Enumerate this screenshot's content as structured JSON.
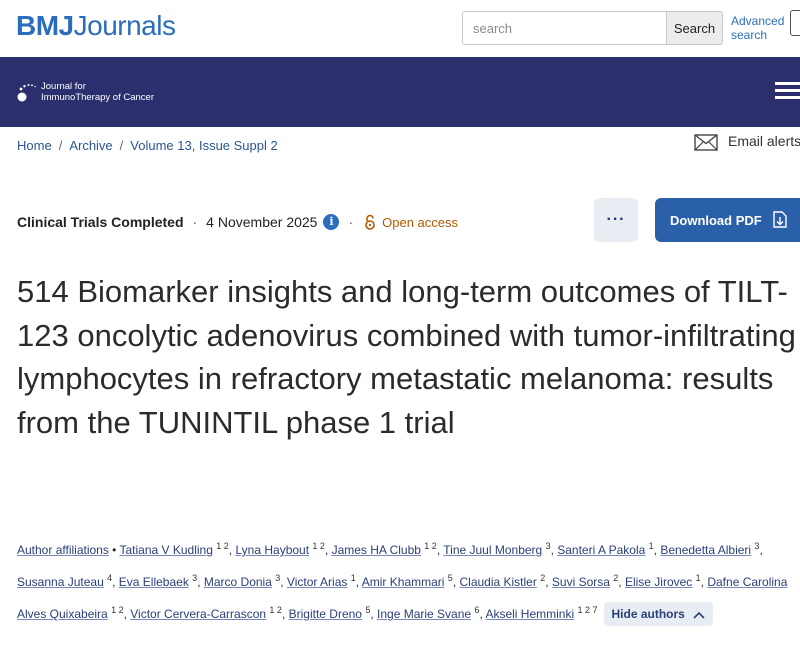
{
  "header": {
    "brand_bmj": "BMJ",
    "brand_journals": "Journals",
    "search_placeholder": "search",
    "search_button": "Search",
    "advanced_search": "Advanced search"
  },
  "banner": {
    "journal_line1": "Journal for",
    "journal_line2": "ImmunoTherapy of Cancer",
    "menu_icon": "hamburger-icon",
    "bg_color": "#2b2f6e"
  },
  "breadcrumb": [
    "Home",
    "Archive",
    "Volume 13, Issue Suppl 2"
  ],
  "email_alerts": "Email alerts",
  "article": {
    "type": "Clinical Trials Completed",
    "date": "4 November 2025",
    "info_icon": "i",
    "access": "Open access",
    "more_button": "···",
    "download_button": "Download PDF",
    "title": "514 Biomarker insights and long-term outcomes of TILT-123 oncolytic adenovirus combined with tumor-infiltrating lymphocytes in refractory metastatic melanoma: results from the TUNINTIL phase 1 trial"
  },
  "authors": {
    "affiliations_label": "Author affiliations",
    "hide_label": "Hide authors",
    "list": [
      {
        "name": "Tatiana V Kudling",
        "sup": "1 2"
      },
      {
        "name": "Lyna Haybout",
        "sup": "1 2"
      },
      {
        "name": "James HA Clubb",
        "sup": "1 2"
      },
      {
        "name": "Tine Juul Monberg",
        "sup": "3"
      },
      {
        "name": "Santeri A Pakola",
        "sup": "1"
      },
      {
        "name": "Benedetta Albieri",
        "sup": "3"
      },
      {
        "name": "Susanna Juteau",
        "sup": "4"
      },
      {
        "name": "Eva Ellebaek",
        "sup": "3"
      },
      {
        "name": "Marco Donia",
        "sup": "3"
      },
      {
        "name": "Victor Arias",
        "sup": "1"
      },
      {
        "name": "Amir Khammari",
        "sup": "5"
      },
      {
        "name": "Claudia Kistler",
        "sup": "2"
      },
      {
        "name": "Suvi Sorsa",
        "sup": "2"
      },
      {
        "name": "Elise Jirovec",
        "sup": "1"
      },
      {
        "name": "Dafne Carolina Alves Quixabeira",
        "sup": "1 2"
      },
      {
        "name": "Victor Cervera-Carrascon",
        "sup": "1 2"
      },
      {
        "name": "Brigitte Dreno",
        "sup": "5"
      },
      {
        "name": "Inge Marie Svane",
        "sup": "6"
      },
      {
        "name": "Akseli Hemminki",
        "sup": "1 2 7"
      }
    ]
  },
  "colors": {
    "brand_blue": "#2a6ebb",
    "banner_navy": "#2b2f6e",
    "download_blue": "#2a5faa",
    "open_access_orange": "#b05a00"
  }
}
